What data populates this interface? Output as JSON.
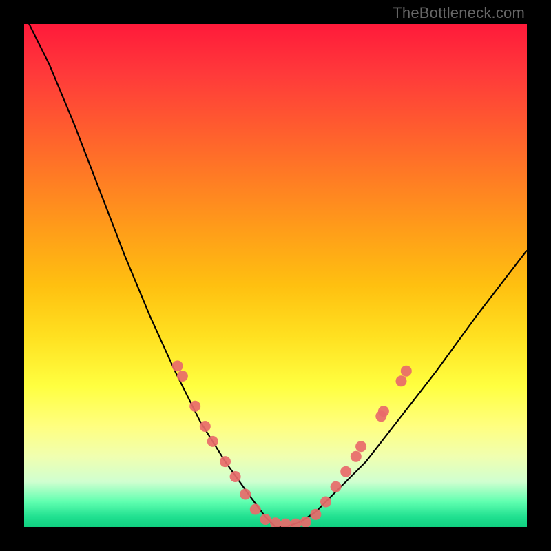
{
  "attribution": "TheBottleneck.com",
  "chart_data": {
    "type": "line",
    "title": "",
    "xlabel": "",
    "ylabel": "",
    "xlim": [
      0,
      100
    ],
    "ylim": [
      0,
      100
    ],
    "series": [
      {
        "name": "curve",
        "x": [
          0,
          5,
          10,
          15,
          20,
          25,
          30,
          35,
          40,
          45,
          48,
          50,
          52,
          55,
          58,
          62,
          68,
          75,
          82,
          90,
          100
        ],
        "y": [
          102,
          92,
          80,
          67,
          54,
          42,
          31,
          21,
          13,
          6,
          2,
          0,
          0,
          1,
          3,
          7,
          13,
          22,
          31,
          42,
          55
        ]
      }
    ],
    "markers": [
      {
        "x": 30.5,
        "y": 32
      },
      {
        "x": 31.5,
        "y": 30
      },
      {
        "x": 34,
        "y": 24
      },
      {
        "x": 36,
        "y": 20
      },
      {
        "x": 37.5,
        "y": 17
      },
      {
        "x": 40,
        "y": 13
      },
      {
        "x": 42,
        "y": 10
      },
      {
        "x": 44,
        "y": 6.5
      },
      {
        "x": 46,
        "y": 3.5
      },
      {
        "x": 48,
        "y": 1.5
      },
      {
        "x": 50,
        "y": 0.8
      },
      {
        "x": 52,
        "y": 0.6
      },
      {
        "x": 54,
        "y": 0.6
      },
      {
        "x": 56,
        "y": 1.0
      },
      {
        "x": 58,
        "y": 2.5
      },
      {
        "x": 60,
        "y": 5
      },
      {
        "x": 62,
        "y": 8
      },
      {
        "x": 64,
        "y": 11
      },
      {
        "x": 66,
        "y": 14
      },
      {
        "x": 67,
        "y": 16
      },
      {
        "x": 71,
        "y": 22
      },
      {
        "x": 71.5,
        "y": 23
      },
      {
        "x": 75,
        "y": 29
      },
      {
        "x": 76,
        "y": 31
      }
    ],
    "marker_color": "#e86a6a",
    "curve_color": "#000000"
  }
}
